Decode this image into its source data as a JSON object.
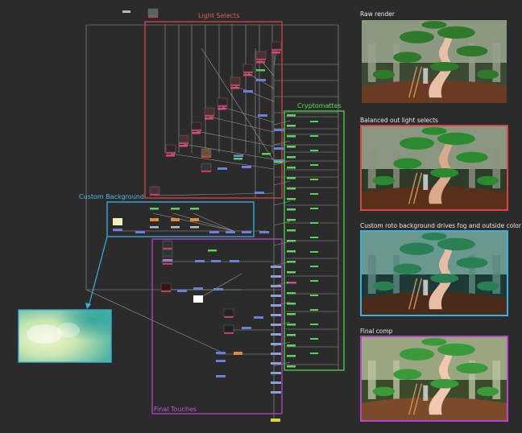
{
  "groups": {
    "light_selects": {
      "label": "Light Selects",
      "color": "#d64545"
    },
    "cryptomattes": {
      "label": "Cryptomattes",
      "color": "#52d152"
    },
    "custom_background": {
      "label": "Custom Background",
      "color": "#3ab0e0"
    },
    "final_touches": {
      "label": "Final Touches",
      "color": "#b844c8"
    }
  },
  "panels": [
    {
      "title": "Raw render",
      "border": "none",
      "variant": "raw"
    },
    {
      "title": "Balanced out light selects",
      "border": "#d64545",
      "variant": "balanced"
    },
    {
      "title": "Custom roto background drives fog and outside color",
      "border": "#3ab0e0",
      "variant": "roto"
    },
    {
      "title": "Final comp",
      "border": "#b844c8",
      "variant": "final"
    }
  ],
  "colors": {
    "background": "#2b2b2b",
    "wire": "#9a9a9a",
    "node_blue": "#6b7fd6",
    "node_green": "#5ad25a",
    "node_orange": "#d98a3a",
    "node_pink": "#d04a7a",
    "node_purple": "#9b7fd0",
    "node_yellow": "#d8d83a"
  }
}
